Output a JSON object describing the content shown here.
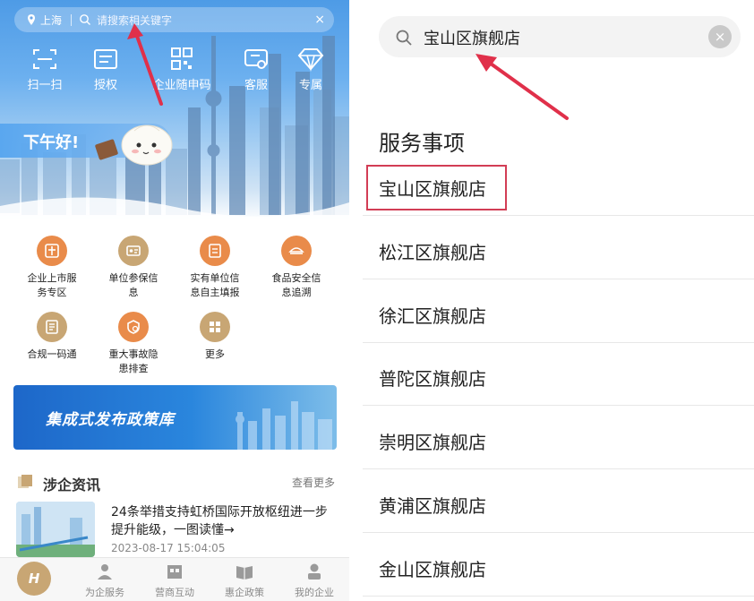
{
  "left": {
    "location": "上海",
    "search_placeholder": "请搜索相关键字",
    "clear_symbol": "×",
    "quick_actions": [
      {
        "label": "扫一扫",
        "icon": "scan-icon"
      },
      {
        "label": "授权",
        "icon": "authorize-icon"
      },
      {
        "label": "企业随申码",
        "icon": "qr-code-icon"
      },
      {
        "label": "客服",
        "icon": "customer-service-icon"
      },
      {
        "label": "专属",
        "icon": "diamond-icon"
      }
    ],
    "greeting": "下午好!",
    "services": [
      {
        "line1": "企业上市服",
        "line2": "务专区",
        "icon": "listing-icon",
        "color": "#e98b4a"
      },
      {
        "line1": "单位参保信",
        "line2": "息",
        "icon": "insurance-card-icon",
        "color": "#c8a674"
      },
      {
        "line1": "实有单位信",
        "line2": "息自主填报",
        "icon": "report-icon",
        "color": "#e98b4a"
      },
      {
        "line1": "食品安全信",
        "line2": "息追溯",
        "icon": "food-safety-icon",
        "color": "#e98b4a"
      },
      {
        "line1": "合规一码通",
        "line2": "",
        "icon": "compliance-icon",
        "color": "#c8a674"
      },
      {
        "line1": "重大事故隐",
        "line2": "患排查",
        "icon": "hazard-check-icon",
        "color": "#e98b4a"
      },
      {
        "line1": "更多",
        "line2": "",
        "icon": "more-grid-icon",
        "color": "#c8a674"
      }
    ],
    "banner_text": "集成式发布政策库",
    "news": {
      "section_title": "涉企资讯",
      "more": "查看更多",
      "headline": "24条举措支持虹桥国际开放枢纽进一步提升能级，一图读懂→",
      "time": "2023-08-17 15:04:05"
    },
    "tabs": [
      {
        "label": "",
        "icon": "home-logo-icon"
      },
      {
        "label": "为企服务",
        "icon": "service-person-icon"
      },
      {
        "label": "营商互动",
        "icon": "interaction-icon"
      },
      {
        "label": "惠企政策",
        "icon": "policy-book-icon"
      },
      {
        "label": "我的企业",
        "icon": "my-enterprise-icon"
      }
    ],
    "home_logo": "H"
  },
  "right": {
    "search_value": "宝山区旗舰店",
    "clear_symbol": "×",
    "section_title": "服务事项",
    "results": [
      "宝山区旗舰店",
      "松江区旗舰店",
      "徐汇区旗舰店",
      "普陀区旗舰店",
      "崇明区旗舰店",
      "黄浦区旗舰店",
      "金山区旗舰店"
    ]
  },
  "colors": {
    "arrow": "#e0304a",
    "highlight": "#d23d55",
    "accent_gold": "#c8a674",
    "accent_orange": "#e98b4a"
  }
}
